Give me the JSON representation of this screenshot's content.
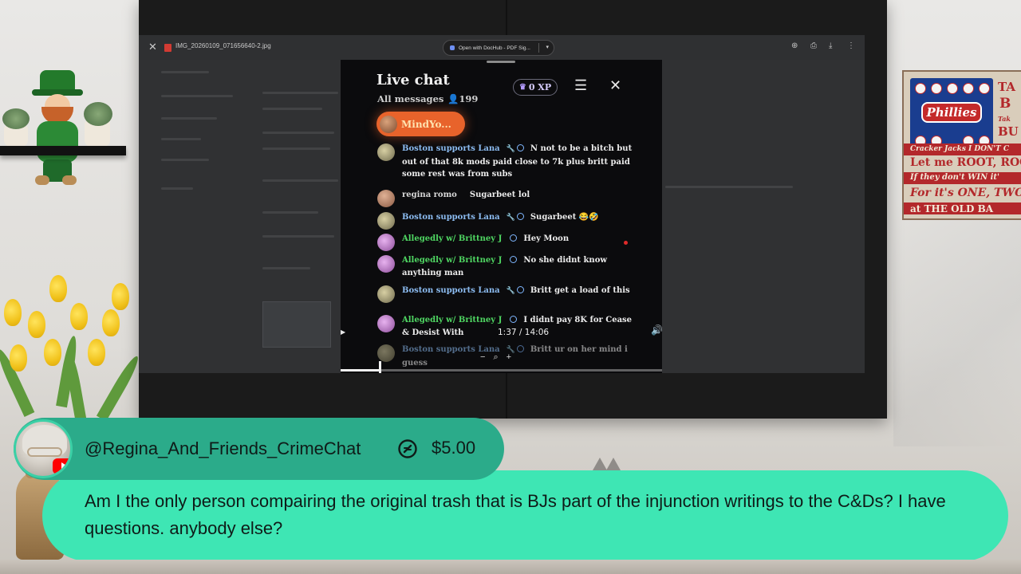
{
  "viewer": {
    "filename": "IMG_20260109_071656640-2.jpg",
    "open_with": "Open with DocHub - PDF Sig..."
  },
  "live_chat": {
    "title": "Live chat",
    "filter": "All messages",
    "viewer_count": "199",
    "xp": "0 XP",
    "pinned_name": "MindYo...",
    "messages": [
      {
        "author": "Boston supports Lana",
        "color": "blue",
        "text": "N not to be a bitch but out of that 8k mods paid close to 7k plus britt paid some rest was from subs",
        "has_wrench": true,
        "has_badge": true
      },
      {
        "author": "regina romo",
        "color": "gray",
        "text": "Sugarbeet lol",
        "has_wrench": false,
        "has_badge": false
      },
      {
        "author": "Boston supports Lana",
        "color": "blue",
        "text": "Sugarbeet 😂🤣",
        "has_wrench": true,
        "has_badge": true
      },
      {
        "author": "Allegedly w/ Brittney J",
        "color": "green",
        "text": "Hey Moon",
        "has_wrench": false,
        "has_badge": true
      },
      {
        "author": "Allegedly w/ Brittney J",
        "color": "green",
        "text": "No she didnt know anything man",
        "has_wrench": false,
        "has_badge": true
      },
      {
        "author": "Boston supports Lana",
        "color": "blue",
        "text": "Britt get a load of this",
        "has_wrench": true,
        "has_badge": true
      },
      {
        "author": "Allegedly w/ Brittney J",
        "color": "green",
        "text": "I didnt pay 8K for Cease & Desist With",
        "has_wrench": false,
        "has_badge": true
      },
      {
        "author": "Boston supports Lana",
        "color": "blue",
        "text": "Britt ur on her mind i guess",
        "has_wrench": true,
        "has_badge": true
      }
    ],
    "video_time": "1:37 / 14:06",
    "progress": 0.12
  },
  "superchat": {
    "username": "@Regina_And_Friends_CrimeChat",
    "amount": "$5.00",
    "message": "Am I the only person compairing the original trash that is BJs part of the injunction writings to the C&Ds? I have questions. anybody else?",
    "colors": {
      "header": "#2bab8a",
      "body": "#3ee6b4"
    }
  },
  "decor": {
    "sign_logo": "Phillies",
    "sign_lines": [
      "TA",
      "B",
      "Tak",
      "BU",
      "Cracker Jacks I DON'T C",
      "Let me ROOT, ROOT, R",
      "If they don't WIN it'",
      "For it's ONE, TWO, TH",
      "at THE OLD BA"
    ]
  }
}
